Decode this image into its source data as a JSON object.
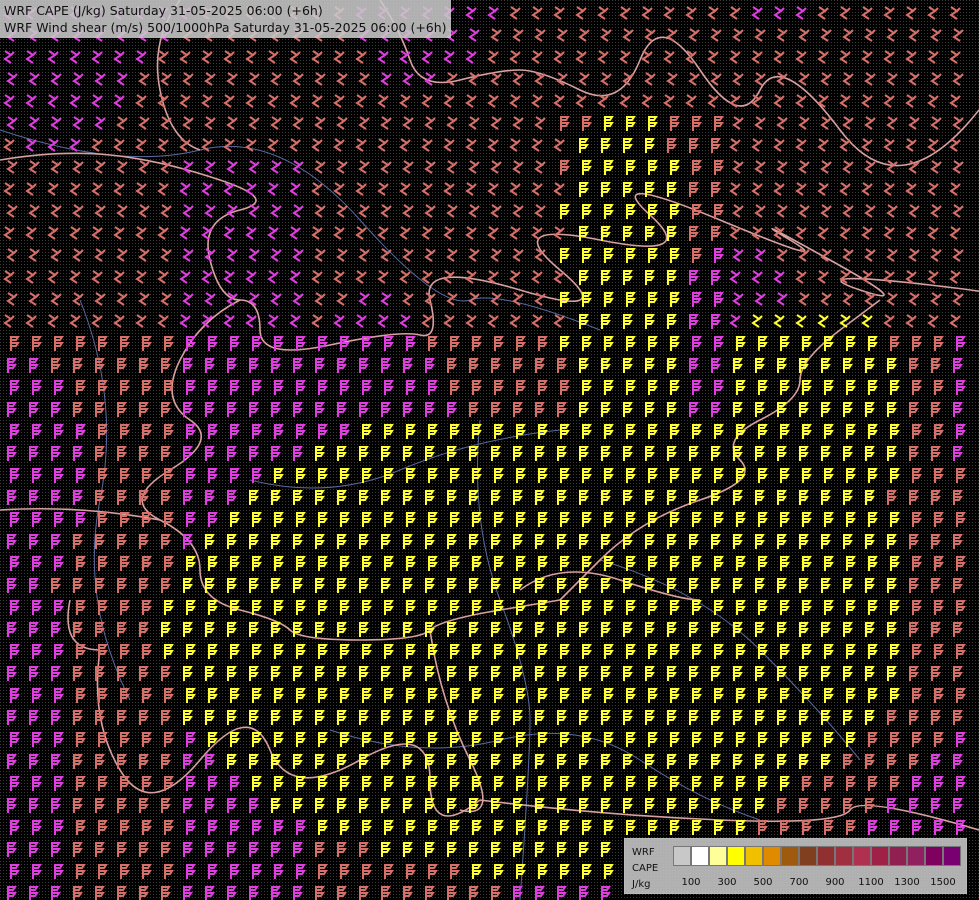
{
  "titles": {
    "line1": "WRF CAPE (J/kg) Saturday 31-05-2025 06:00 (+6h)",
    "line2": "WRF Wind shear (m/s) 500/1000hPa Saturday 31-05-2025 06:00 (+6h)"
  },
  "legend": {
    "label_lines": [
      "WRF",
      "CAPE",
      "J/kg"
    ],
    "colors": [
      "#c8c8c8",
      "#ffffff",
      "#ffff99",
      "#ffff00",
      "#f0c000",
      "#e08a00",
      "#a05a10",
      "#804020",
      "#903030",
      "#a03040",
      "#b03050",
      "#a02048",
      "#902050",
      "#902060",
      "#800060",
      "#780070"
    ],
    "tick_labels": [
      "100",
      "300",
      "500",
      "700",
      "900",
      "1100",
      "1300",
      "1500"
    ]
  },
  "barb_colors": {
    "dark": "#e03ee0",
    "mid": "#d8706a",
    "yellow": "#ffff33"
  },
  "map_colors": {
    "border": "#d8a0a0",
    "river": "#5a6aa0"
  }
}
